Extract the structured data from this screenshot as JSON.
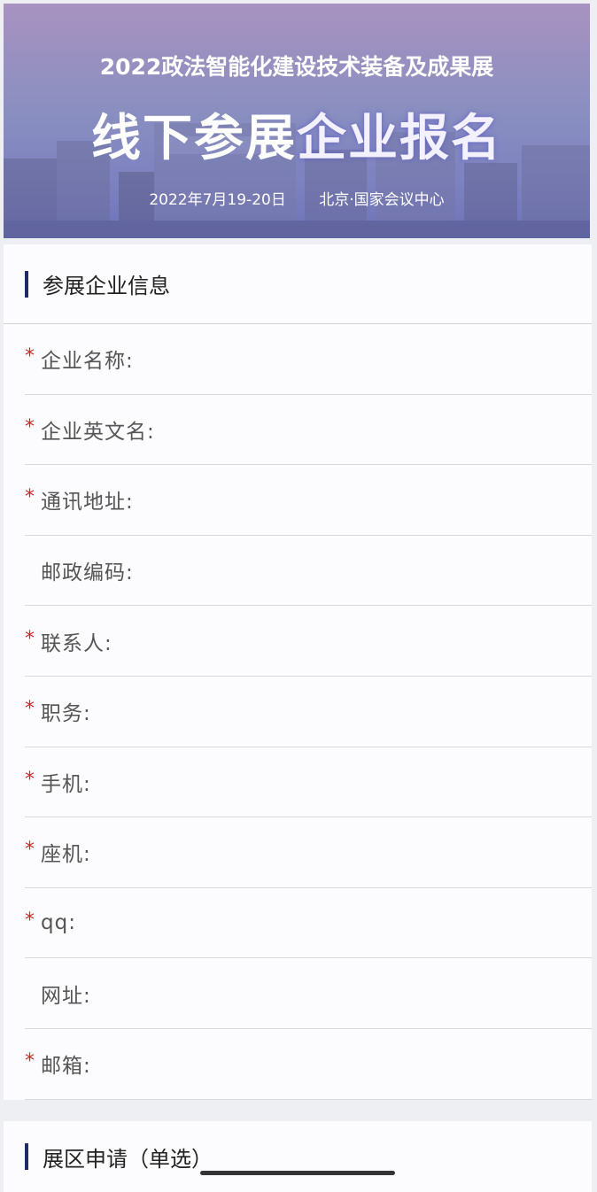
{
  "banner": {
    "title": "2022政法智能化建设技术装备及成果展",
    "headline_left": "线下参展",
    "headline_right": "企业报名",
    "date": "2022年7月19-20日",
    "venue": "北京·国家会议中心"
  },
  "info_section": {
    "title": "参展企业信息",
    "fields": [
      {
        "label": "企业名称:",
        "required": "*",
        "value": ""
      },
      {
        "label": "企业英文名:",
        "required": "*",
        "value": ""
      },
      {
        "label": "通讯地址:",
        "required": "*",
        "value": ""
      },
      {
        "label": "邮政编码:",
        "required": "",
        "value": ""
      },
      {
        "label": "联系人:",
        "required": "*",
        "value": ""
      },
      {
        "label": "职务:",
        "required": "*",
        "value": ""
      },
      {
        "label": "手机:",
        "required": "*",
        "value": ""
      },
      {
        "label": "座机:",
        "required": "*",
        "value": ""
      },
      {
        "label": "qq:",
        "required": "*",
        "value": ""
      },
      {
        "label": "网址:",
        "required": "",
        "value": ""
      },
      {
        "label": "邮箱:",
        "required": "*",
        "value": ""
      }
    ]
  },
  "zone_section": {
    "title": "展区申请（单选）"
  },
  "colors": {
    "accent": "#1f2a6b",
    "required": "#d0262c",
    "banner_top": "#a892c0",
    "banner_bottom": "#6e73b8"
  }
}
